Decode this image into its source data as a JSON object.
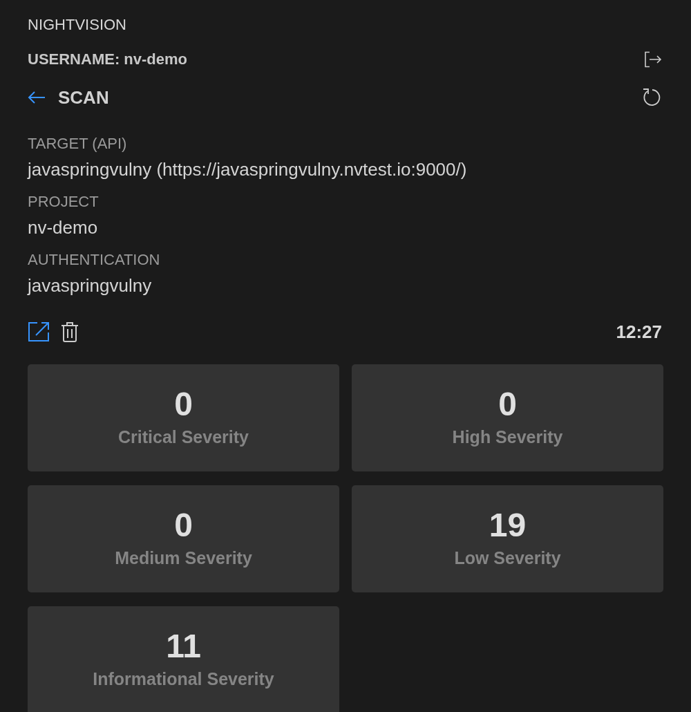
{
  "panel": {
    "title": "NIGHTVISION"
  },
  "user": {
    "label": "USERNAME: nv-demo"
  },
  "scan_header": {
    "title": "SCAN"
  },
  "details": [
    {
      "label": "TARGET (API)",
      "value": "javaspringvulny (https://javaspringvulny.nvtest.io:9000/)"
    },
    {
      "label": "PROJECT",
      "value": "nv-demo"
    },
    {
      "label": "AUTHENTICATION",
      "value": "javaspringvulny"
    }
  ],
  "time": "12:27",
  "severity_cards": [
    {
      "count": "0",
      "label": "Critical Severity"
    },
    {
      "count": "0",
      "label": "High Severity"
    },
    {
      "count": "0",
      "label": "Medium Severity"
    },
    {
      "count": "19",
      "label": "Low Severity"
    },
    {
      "count": "11",
      "label": "Informational Severity"
    }
  ]
}
